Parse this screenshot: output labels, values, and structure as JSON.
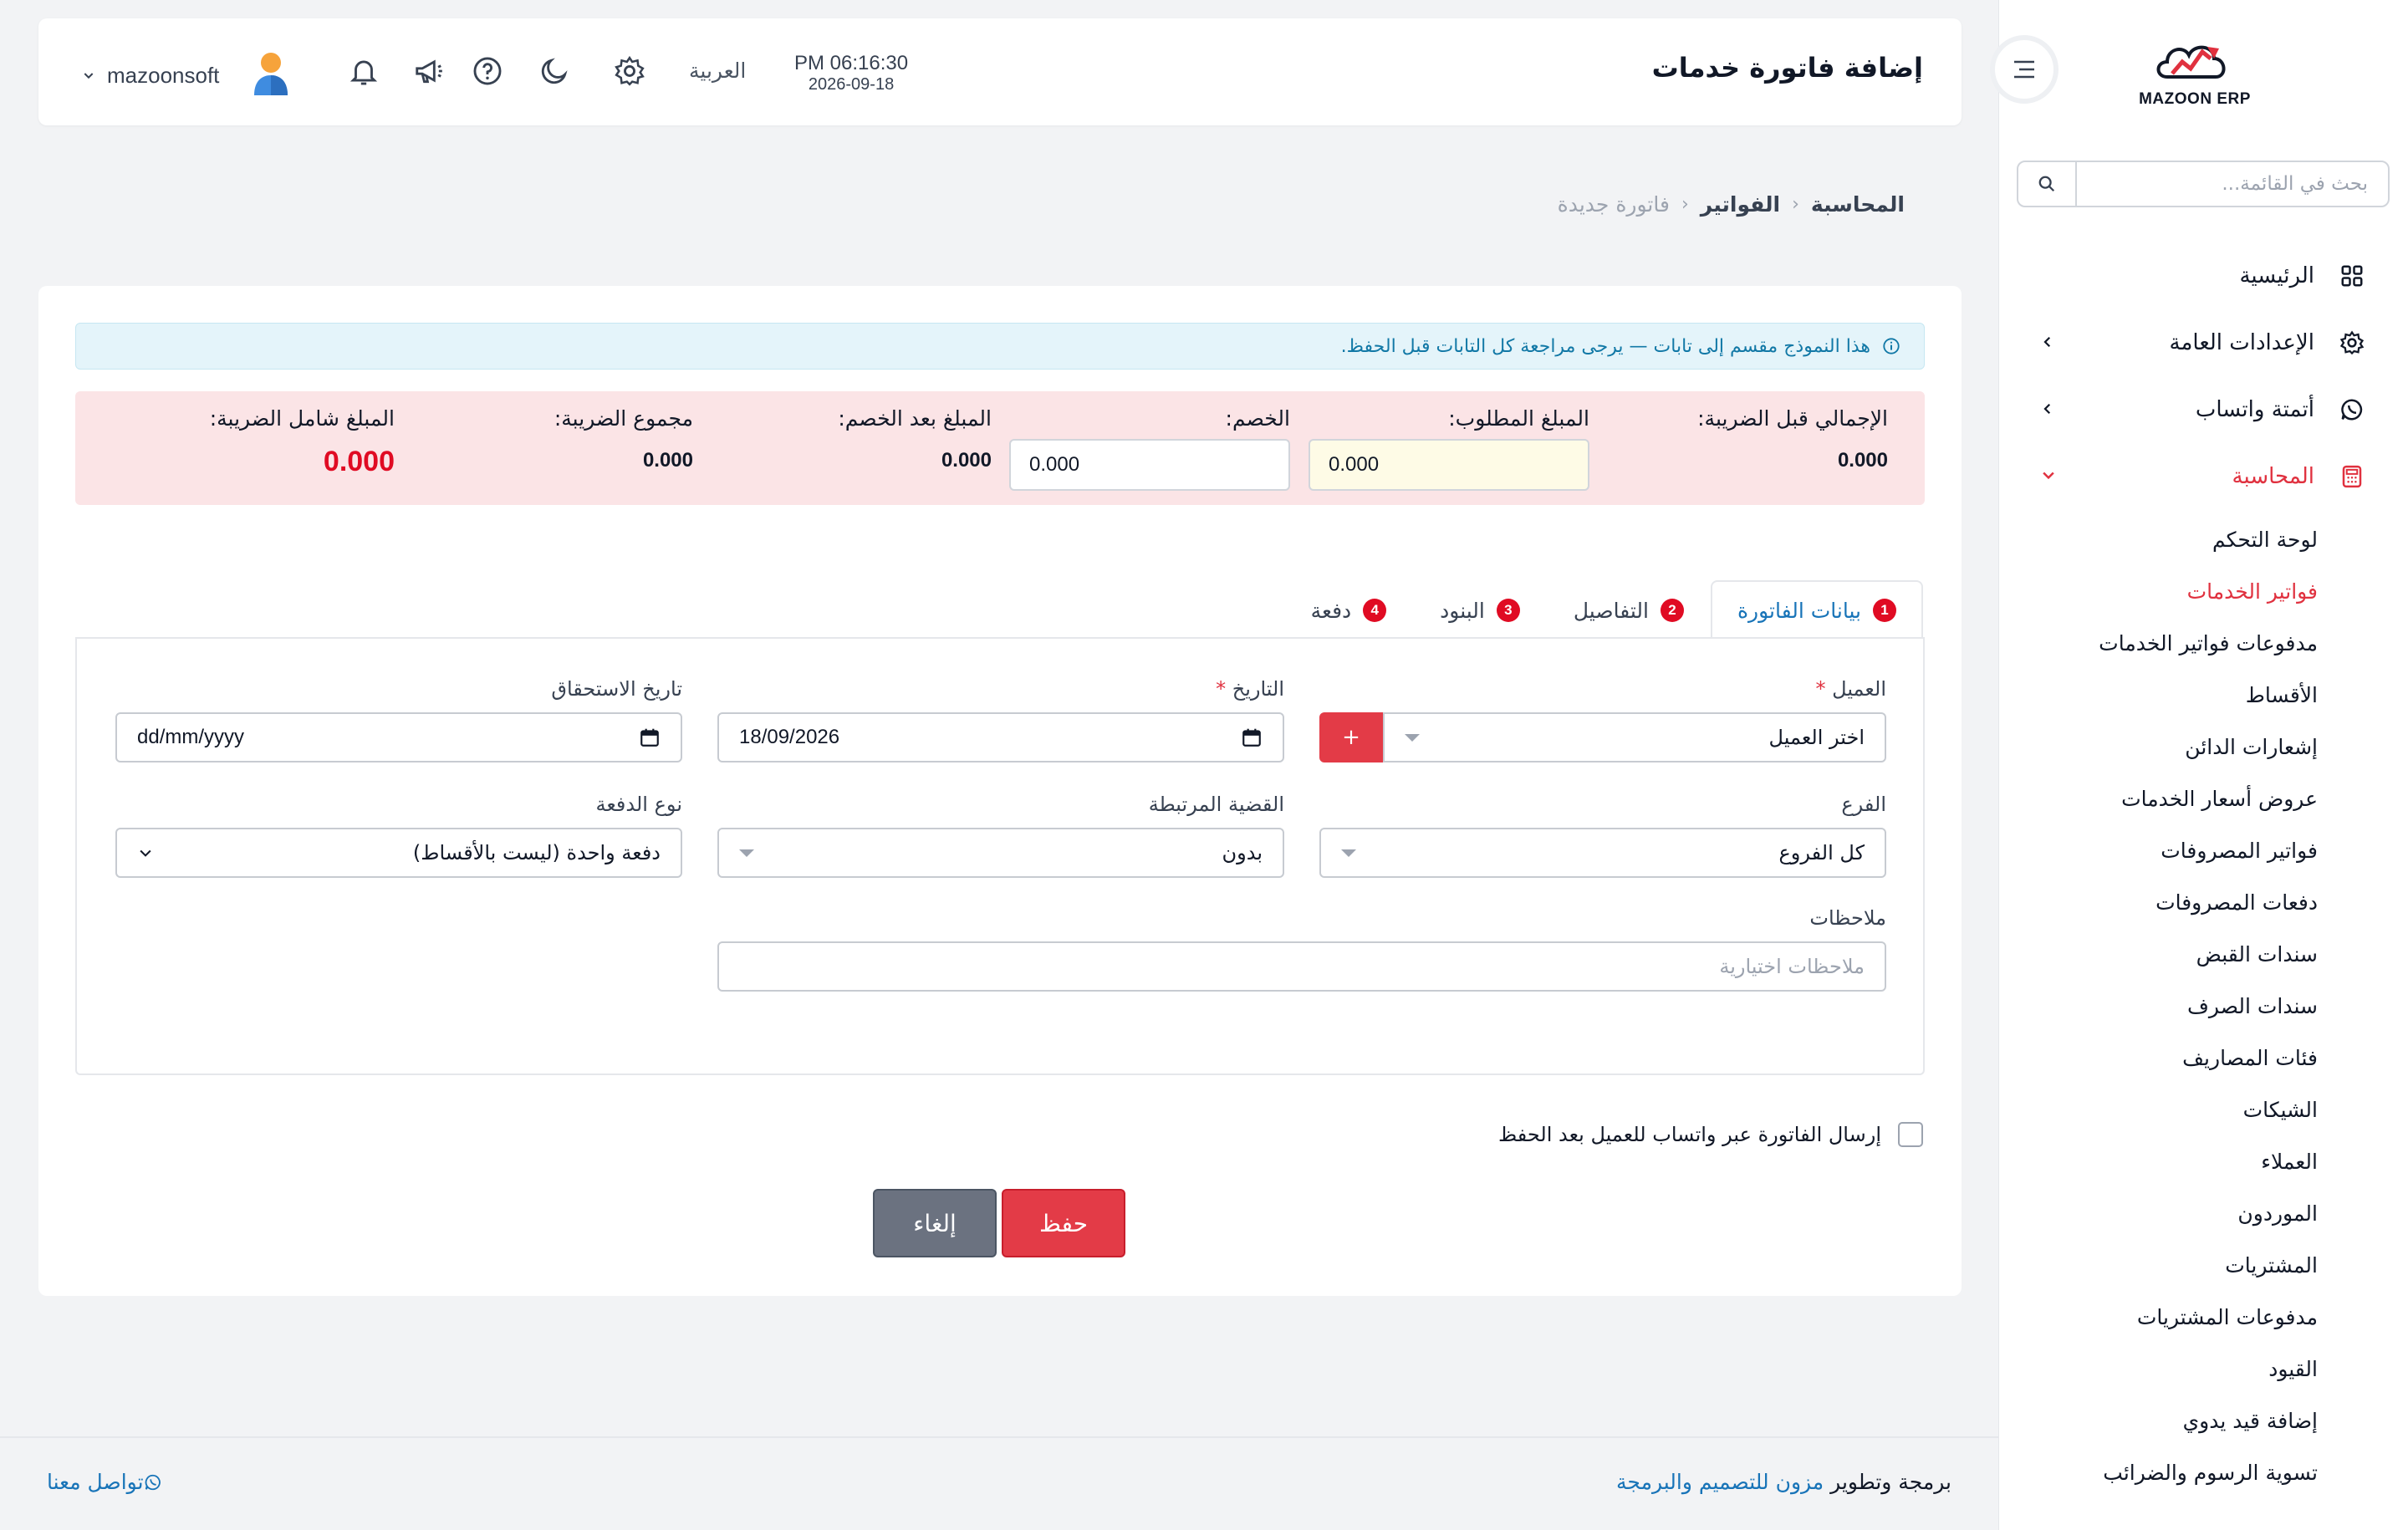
{
  "sidebar": {
    "logo_text": "MAZOON ERP",
    "search_placeholder": "بحث في القائمة...",
    "items": [
      {
        "label": "الرئيسية",
        "icon": "grid-icon"
      },
      {
        "label": "الإعدادات العامة",
        "icon": "gear-icon"
      },
      {
        "label": "أتمتة واتساب",
        "icon": "whatsapp-icon"
      },
      {
        "label": "المحاسبة",
        "icon": "calculator-icon"
      }
    ],
    "accounting_sub": [
      "لوحة التحكم",
      "فواتير الخدمات",
      "مدفوعات فواتير الخدمات",
      "الأقساط",
      "إشعارات الدائن",
      "عروض أسعار الخدمات",
      "فواتير المصروفات",
      "دفعات المصروفات",
      "سندات القبض",
      "سندات الصرف",
      "فئات المصاريف",
      "الشيكات",
      "العملاء",
      "الموردون",
      "المشتريات",
      "مدفوعات المشتريات",
      "القيود",
      "إضافة قيد يدوي",
      "تسوية الرسوم والضرائب"
    ],
    "active_sub_index": 1,
    "accent": "#e0313f"
  },
  "header": {
    "title": "إضافة فاتورة خدمات",
    "time": "PM 06:16:30",
    "date": "2026-09-18",
    "language": "العربية",
    "username": "mazoonsoft"
  },
  "breadcrumb": [
    "المحاسبة",
    "الفواتير",
    "فاتورة جديدة"
  ],
  "alert": "هذا النموذج مقسم إلى تابات — يرجى مراجعة كل التابات قبل الحفظ.",
  "totals": {
    "subtotal_label": "الإجمالي قبل الضريبة:",
    "subtotal_value": "0.000",
    "required_label": "المبلغ المطلوب:",
    "required_value": "0.000",
    "discount_label": "الخصم:",
    "discount_value": "0.000",
    "after_discount_label": "المبلغ بعد الخصم:",
    "after_discount_value": "0.000",
    "tax_label": "مجموع الضريبة:",
    "tax_value": "0.000",
    "grand_label": "المبلغ شامل الضريبة:",
    "grand_value": "0.000"
  },
  "tabs": [
    {
      "num": "1",
      "label": "بيانات الفاتورة"
    },
    {
      "num": "2",
      "label": "التفاصيل"
    },
    {
      "num": "3",
      "label": "البنود"
    },
    {
      "num": "4",
      "label": "دفعة"
    }
  ],
  "form": {
    "customer_label": "العميل",
    "customer_value": "اختر العميل",
    "add_symbol": "+",
    "date_label": "التاريخ",
    "date_value": "18/09/2026",
    "due_label": "تاريخ الاستحقاق",
    "due_value": "dd/mm/yyyy",
    "branch_label": "الفرع",
    "branch_value": "كل الفروع",
    "case_label": "القضية المرتبطة",
    "case_value": "بدون",
    "payment_type_label": "نوع الدفعة",
    "payment_type_value": "دفعة واحدة (ليست بالأقساط)",
    "notes_label": "ملاحظات",
    "notes_placeholder": "ملاحظات اختيارية",
    "required_mark": "*"
  },
  "whatsapp_check_label": "إرسال الفاتورة عبر واتساب للعميل بعد الحفظ",
  "buttons": {
    "save": "حفظ",
    "cancel": "إلغاء"
  },
  "footer": {
    "credit_prefix": "برمجة وتطوير",
    "credit_link": "مزون للتصميم والبرمجة",
    "contact": "تواصل معنا"
  },
  "colors": {
    "primary": "#e33b47",
    "link": "#1874b8",
    "info_bg": "#e4f4fa",
    "totals_bg": "#fbe4e6"
  }
}
